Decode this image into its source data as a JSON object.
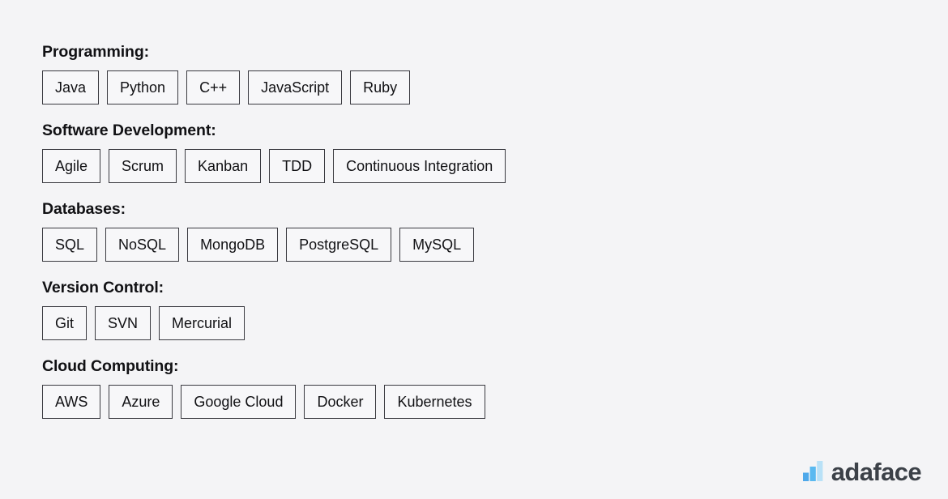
{
  "page": {
    "background_color": "#f4f4f6",
    "text_color": "#111114",
    "tag_border_color": "#3a3a40",
    "tag_fill_color": "#f7f7f9"
  },
  "sections": [
    {
      "heading": "Programming:",
      "tags": [
        "Java",
        "Python",
        "C++",
        "JavaScript",
        "Ruby"
      ]
    },
    {
      "heading": "Software Development:",
      "tags": [
        "Agile",
        "Scrum",
        "Kanban",
        "TDD",
        "Continuous Integration"
      ]
    },
    {
      "heading": "Databases:",
      "tags": [
        "SQL",
        "NoSQL",
        "MongoDB",
        "PostgreSQL",
        "MySQL"
      ]
    },
    {
      "heading": "Version Control:",
      "tags": [
        "Git",
        "SVN",
        "Mercurial"
      ]
    },
    {
      "heading": "Cloud Computing:",
      "tags": [
        "AWS",
        "Azure",
        "Google Cloud",
        "Docker",
        "Kubernetes"
      ]
    }
  ],
  "logo": {
    "wordmark": "adaface",
    "icon": "bar-chart-logo-icon",
    "wordmark_color": "#3c4148",
    "bar_colors": [
      "#4ea8ea",
      "#5ab9f0",
      "#b9e1f7"
    ]
  }
}
